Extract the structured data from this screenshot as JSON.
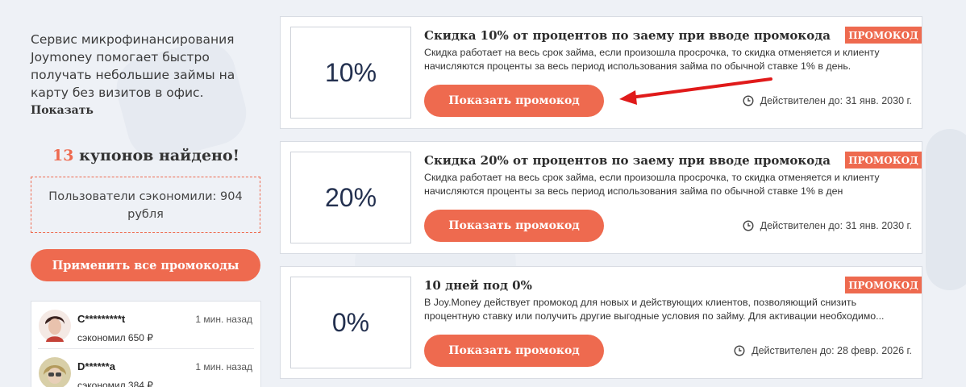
{
  "sidebar": {
    "description": "Сервис микрофинансирования Joymoney помогает быстро получать небольшие займы на карту без визитов в офис.",
    "show_link": "Показать",
    "found_count": "13",
    "found_text": "купонов найдено!",
    "saved_text": "Пользователи сэкономили: 904 рубля",
    "apply_all_label": "Применить все промокоды",
    "users": [
      {
        "name": "C*********t",
        "time": "1 мин. назад",
        "saved": "сэкономил 650 ₽"
      },
      {
        "name": "D******a",
        "time": "1 мин. назад",
        "saved": "сэкономил 384 ₽"
      }
    ]
  },
  "coupons": [
    {
      "percent": "10%",
      "title": "Скидка 10% от процентов по заему при вводе промокода",
      "badge": "ПРОМОКОД",
      "description": "Скидка работает на весь срок займа, если произошла просрочка, то скидка отменяется и клиенту начисляются проценты за весь период использования займа по обычной ставке 1% в день.",
      "button_label": "Показать промокод",
      "valid": "Действителен до: 31 янв. 2030 г."
    },
    {
      "percent": "20%",
      "title": "Скидка 20% от процентов по заему при вводе промокода",
      "badge": "ПРОМОКОД",
      "description": "Скидка работает на весь срок займа, если произошла просрочка, то скидка отменяется и клиенту начисляются проценты за весь период использования займа по обычной ставке 1% в ден",
      "button_label": "Показать промокод",
      "valid": "Действителен до: 31 янв. 2030 г."
    },
    {
      "percent": "0%",
      "title": "10 дней под 0%",
      "badge": "ПРОМОКОД",
      "description": "В Joy.Money действует промокод для новых и действующих клиентов, позволяющий снизить процентную ставку или получить другие выгодные условия по займу. Для активации необходимо...",
      "button_label": "Показать промокод",
      "valid": "Действителен до: 28 февр. 2026 г."
    }
  ],
  "colors": {
    "accent": "#ee6a4f",
    "percent_text": "#23304f",
    "background": "#eef1f6",
    "arrow": "#e01a1a"
  }
}
